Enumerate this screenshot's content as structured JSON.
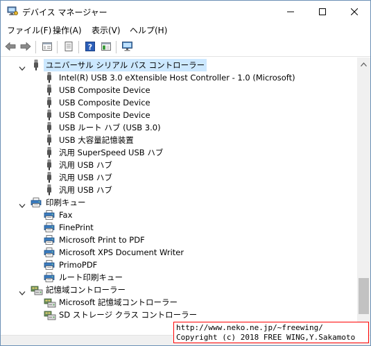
{
  "window": {
    "title": "デバイス マネージャー",
    "icons": {
      "app": "device-manager-icon",
      "minimize": "minimize-icon",
      "maximize": "maximize-icon",
      "close": "close-icon"
    }
  },
  "menu": [
    {
      "label": "ファイル(F)"
    },
    {
      "label": "操作(A)"
    },
    {
      "label": "表示(V)"
    },
    {
      "label": "ヘルプ(H)"
    }
  ],
  "toolbar": {
    "buttons": [
      "back-icon",
      "forward-icon",
      "properties-view-icon",
      "update-driver-icon",
      "help-icon",
      "console-view-icon",
      "monitor-scan-icon"
    ]
  },
  "tree": {
    "usb": {
      "label": "ユニバーサル シリアル バス コントローラー",
      "items": [
        "Intel(R) USB 3.0 eXtensible Host Controller - 1.0 (Microsoft)",
        "USB Composite Device",
        "USB Composite Device",
        "USB Composite Device",
        "USB ルート ハブ (USB 3.0)",
        "USB 大容量記憶装置",
        "汎用 SuperSpeed USB ハブ",
        "汎用 USB ハブ",
        "汎用 USB ハブ",
        "汎用 USB ハブ"
      ]
    },
    "print": {
      "label": "印刷キュー",
      "items": [
        "Fax",
        "FinePrint",
        "Microsoft Print to PDF",
        "Microsoft XPS Document Writer",
        "PrimoPDF",
        "ルート印刷キュー"
      ]
    },
    "storage": {
      "label": "記憶域コントローラー",
      "items": [
        "Microsoft 記憶域コントローラー",
        "SD ストレージ クラス コントローラー"
      ]
    }
  },
  "watermark": {
    "line1": "http://www.neko.ne.jp/~freewing/",
    "line2": "Copyright (c) 2018 FREE WING,Y.Sakamoto"
  },
  "colors": {
    "selection": "#cce8ff",
    "watermark_border": "#ff0000"
  }
}
